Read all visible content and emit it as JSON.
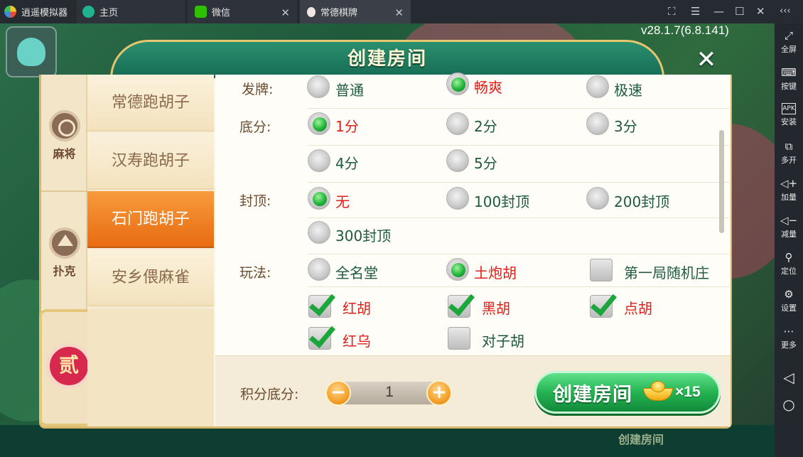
{
  "titlebar": {
    "app_name": "逍遥模拟器",
    "tabs": [
      {
        "label": "主页",
        "icon": "home-tab-icon"
      },
      {
        "label": "微信",
        "icon": "wechat-icon"
      },
      {
        "label": "常德棋牌",
        "icon": "game-app-icon",
        "active": true
      }
    ],
    "window_controls": [
      "fullscreen-icon",
      "menu-icon",
      "minimize-icon",
      "maximize-icon",
      "close-icon",
      "collapse-icon"
    ]
  },
  "sidebar": {
    "items": [
      {
        "label": "全屏",
        "icon": "fullscreen-icon"
      },
      {
        "label": "按键",
        "icon": "keyboard-icon"
      },
      {
        "label": "安装",
        "icon": "apk-icon"
      },
      {
        "label": "多开",
        "icon": "multi-instance-icon"
      },
      {
        "label": "加量",
        "icon": "volume-up-icon"
      },
      {
        "label": "减量",
        "icon": "volume-down-icon"
      },
      {
        "label": "定位",
        "icon": "location-icon"
      },
      {
        "label": "设置",
        "icon": "settings-icon"
      },
      {
        "label": "更多",
        "icon": "more-icon"
      }
    ],
    "nav": [
      "back-icon",
      "home-icon"
    ]
  },
  "game": {
    "version": "v28.1.7(6.8.141)",
    "bottom_labels": [
      "创建房间"
    ]
  },
  "dialog": {
    "title": "创建房间",
    "categories": [
      {
        "label": "麻将",
        "icon": "mahjong-medal-icon"
      },
      {
        "label": "扑克",
        "icon": "spade-medal-icon"
      }
    ],
    "round_seal": "贰",
    "games": [
      {
        "label": "常德跑胡子",
        "selected": false
      },
      {
        "label": "汉寿跑胡子",
        "selected": false
      },
      {
        "label": "石门跑胡子",
        "selected": true
      },
      {
        "label": "安乡偎麻雀",
        "selected": false
      }
    ],
    "options": {
      "deal": {
        "label": "发牌:",
        "choices": [
          {
            "text": "普通",
            "selected": false
          },
          {
            "text": "畅爽",
            "selected": true
          },
          {
            "text": "极速",
            "selected": false
          }
        ]
      },
      "base_score": {
        "label": "底分:",
        "choices": [
          {
            "text": "1分",
            "selected": true
          },
          {
            "text": "2分",
            "selected": false
          },
          {
            "text": "3分",
            "selected": false
          },
          {
            "text": "4分",
            "selected": false
          },
          {
            "text": "5分",
            "selected": false
          }
        ]
      },
      "cap": {
        "label": "封顶:",
        "choices": [
          {
            "text": "无",
            "selected": true
          },
          {
            "text": "100封顶",
            "selected": false
          },
          {
            "text": "200封顶",
            "selected": false
          },
          {
            "text": "300封顶",
            "selected": false
          }
        ]
      },
      "play": {
        "label": "玩法:",
        "radios": [
          {
            "text": "全名堂",
            "selected": false
          },
          {
            "text": "土炮胡",
            "selected": true
          }
        ],
        "checks": [
          {
            "text": "第一局随机庄",
            "checked": false
          },
          {
            "text": "红胡",
            "checked": true
          },
          {
            "text": "黑胡",
            "checked": true
          },
          {
            "text": "点胡",
            "checked": true
          },
          {
            "text": "红乌",
            "checked": true
          },
          {
            "text": "对子胡",
            "checked": false
          }
        ]
      }
    },
    "footer": {
      "score_label": "积分底分:",
      "score_value": "1",
      "minus": "−",
      "plus": "+",
      "create_label": "创建房间",
      "cost": "×15"
    }
  },
  "colors": {
    "selected_text": "#e0201b",
    "option_text": "#1e5a3d",
    "accent_orange": "#e96b12",
    "create_green": "#25b352"
  }
}
